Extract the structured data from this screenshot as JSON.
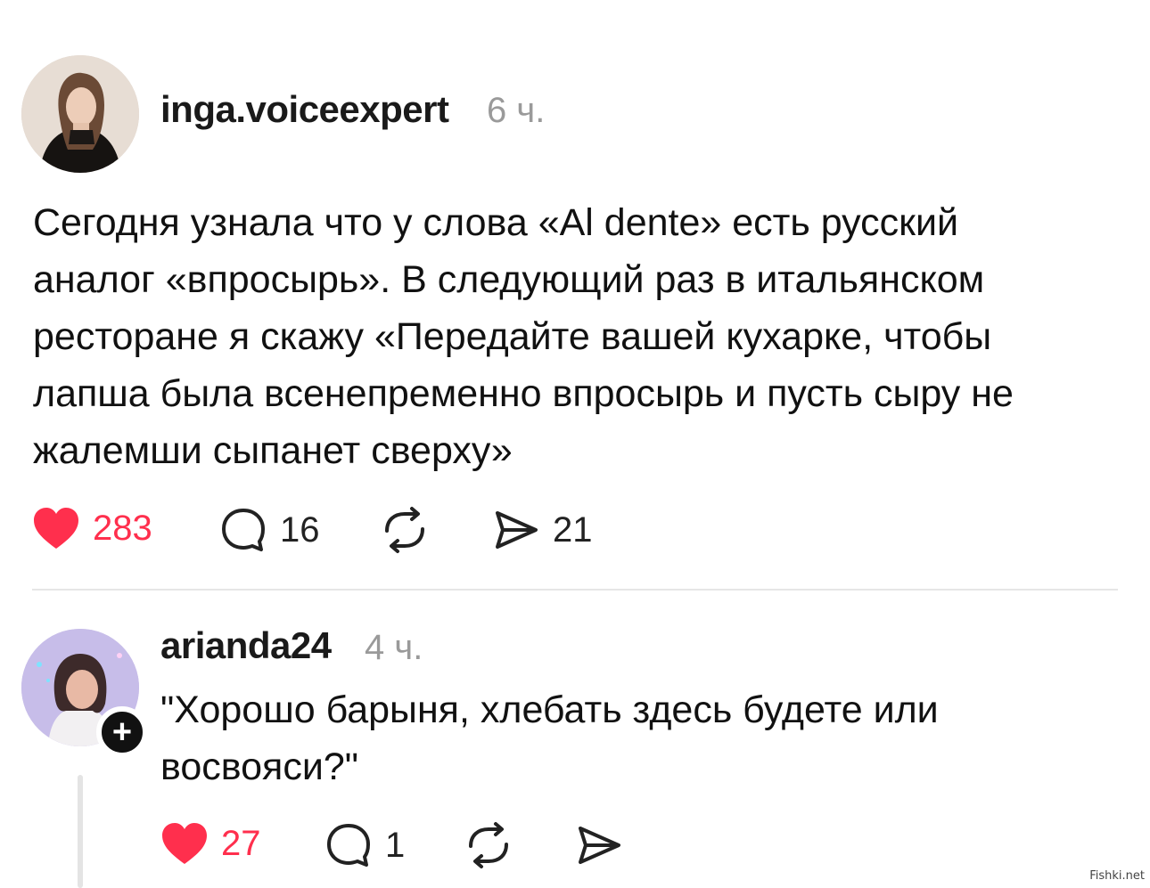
{
  "post": {
    "username": "inga.voiceexpert",
    "time": "6 ч.",
    "text_lines": [
      "Сегодня узнала что у слова «Al dente» есть русский",
      "аналог «впросырь». В следующий раз в итальянском",
      "ресторане я скажу «Передайте вашей кухарке, чтобы",
      "лапша была всенепременно впросырь и пусть сыру не",
      "жалемши сыпанет сверху»"
    ],
    "likes": "283",
    "comments": "16",
    "shares": "21"
  },
  "reply": {
    "username": "arianda24",
    "time": "4 ч.",
    "text_lines": [
      "\"Хорошо барыня, хлебать здесь будете или",
      "восвояси?\""
    ],
    "likes": "27",
    "comments": "1"
  },
  "icons": {
    "like": "heart-filled-icon",
    "comment": "speech-bubble-icon",
    "repost": "repost-arrows-icon",
    "share": "paper-plane-icon",
    "follow": "plus-icon"
  },
  "colors": {
    "like": "#ff2f4d",
    "muted": "#9a9a9a",
    "text": "#111111"
  },
  "watermark": "Fishki.net"
}
